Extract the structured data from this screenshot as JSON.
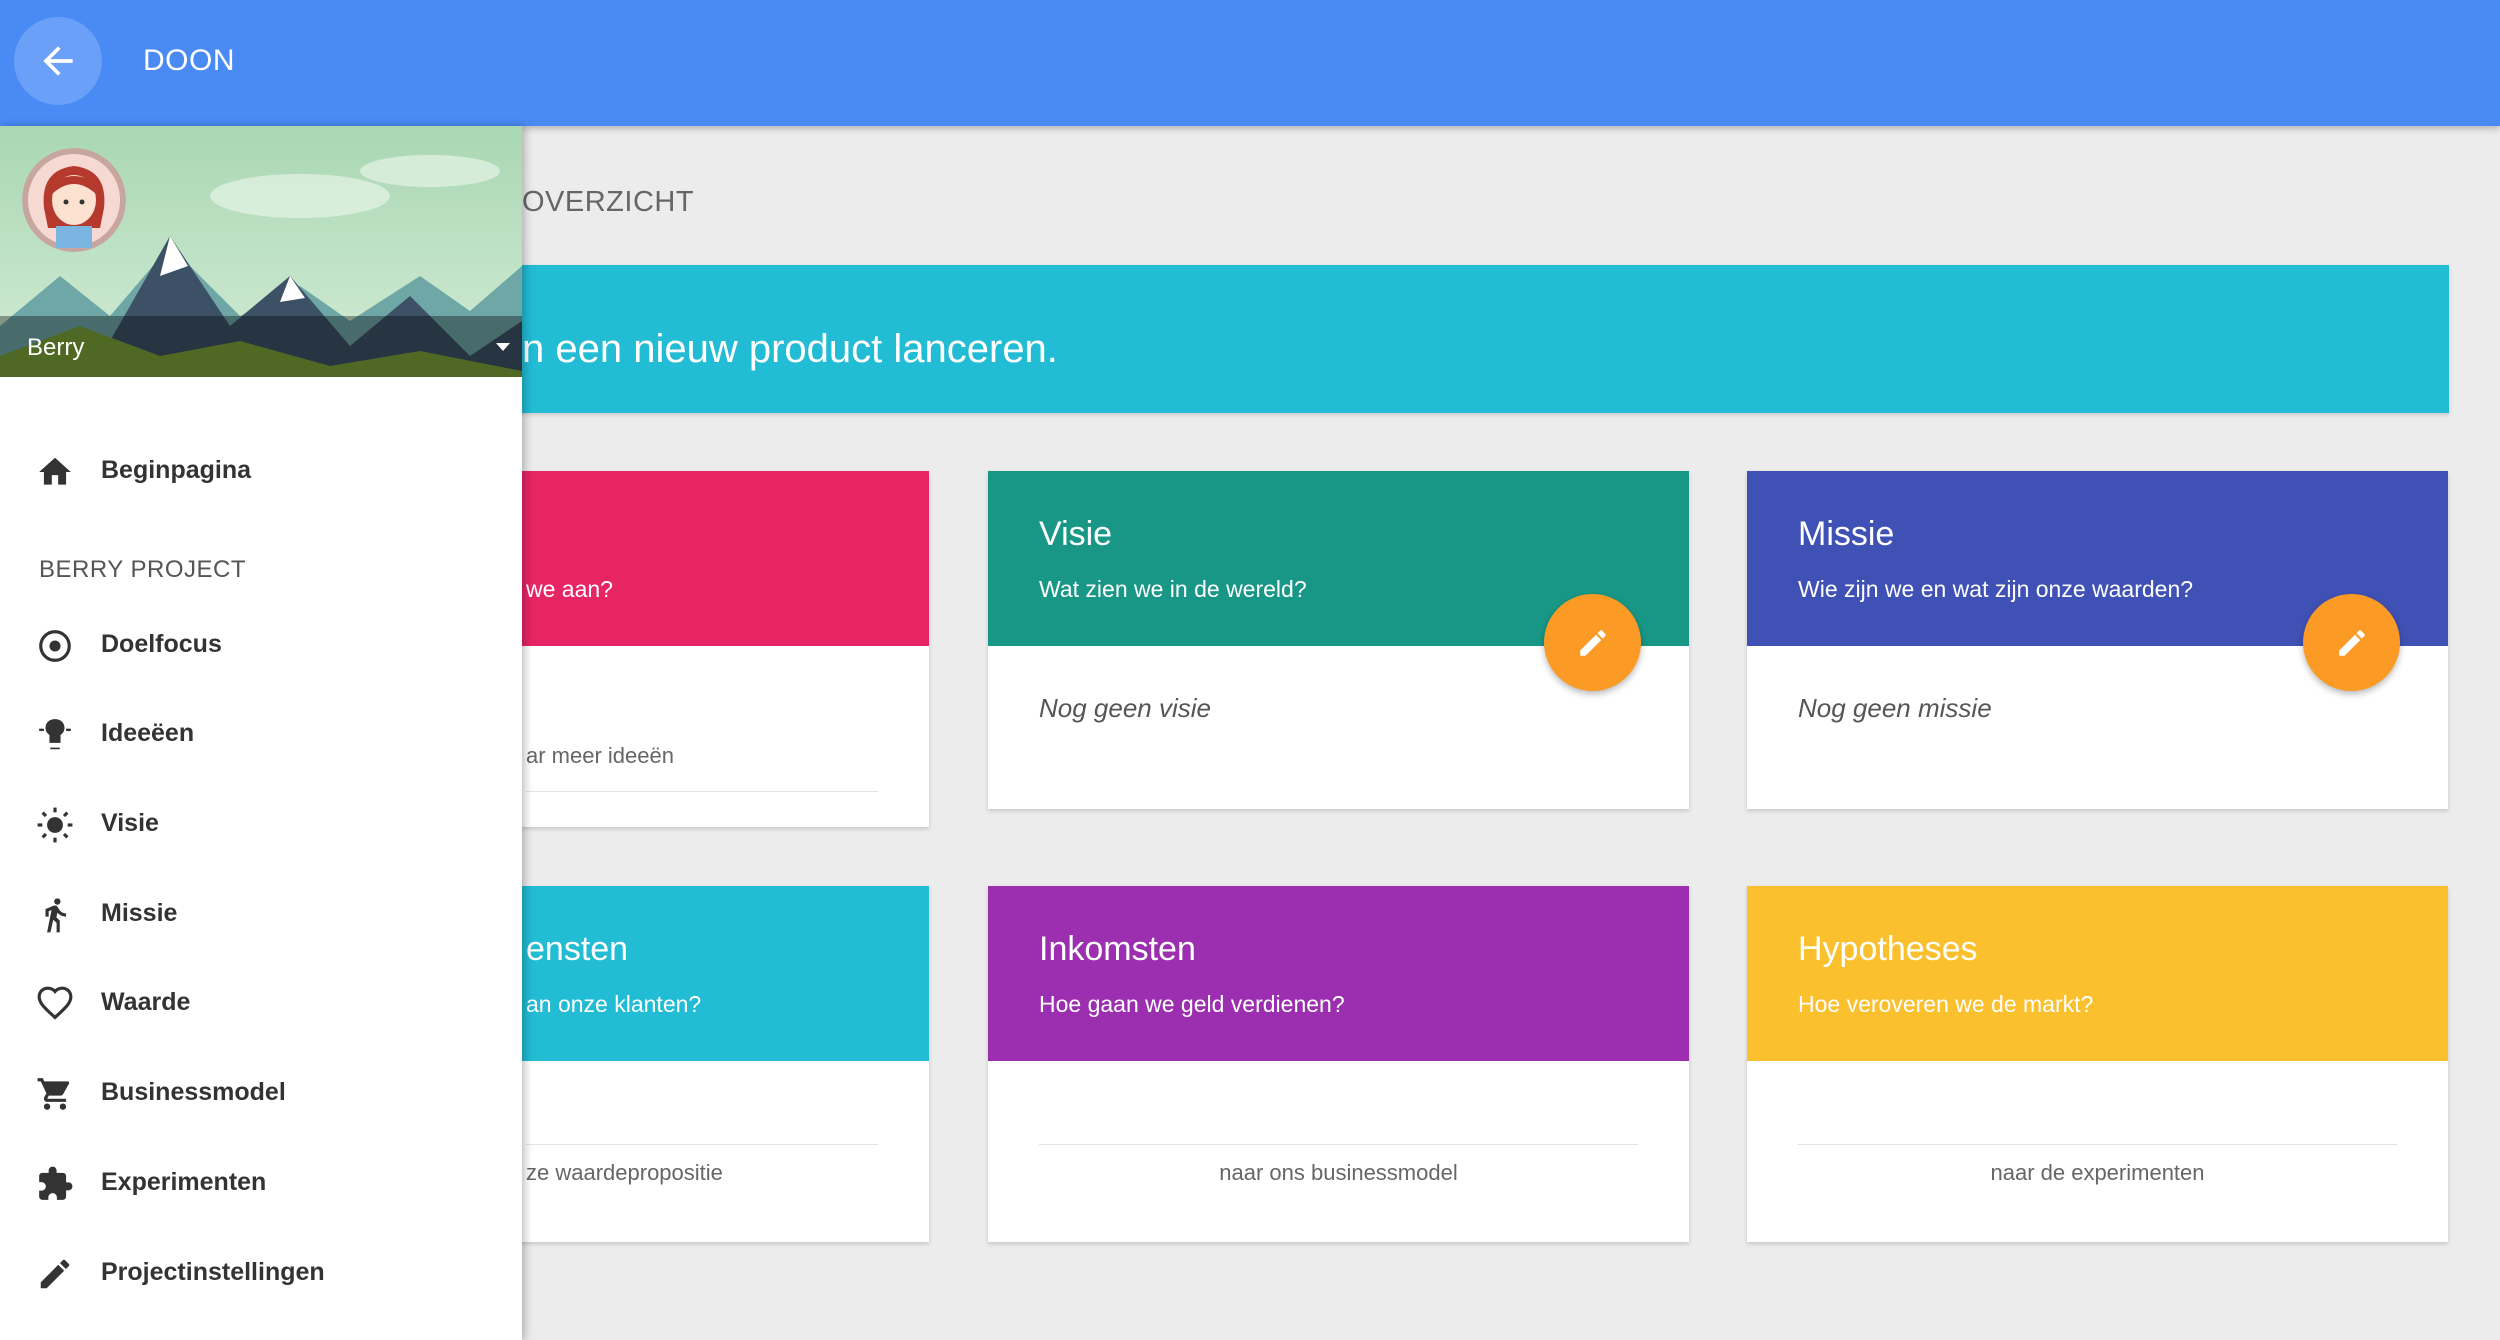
{
  "appbar": {
    "title": "DOON",
    "back_icon": "arrow-left-icon",
    "color": "#4a8af4"
  },
  "drawer": {
    "user_name": "Berry",
    "section_label": "BERRY PROJECT",
    "items": [
      {
        "label": "Beginpagina",
        "icon": "home-icon"
      },
      {
        "label": "Doelfocus",
        "icon": "target-icon"
      },
      {
        "label": "Ideeëen",
        "icon": "lightbulb-icon"
      },
      {
        "label": "Visie",
        "icon": "sun-icon"
      },
      {
        "label": "Missie",
        "icon": "walking-person-icon"
      },
      {
        "label": "Waarde",
        "icon": "heart-icon"
      },
      {
        "label": "Businessmodel",
        "icon": "cart-icon"
      },
      {
        "label": "Experimenten",
        "icon": "puzzle-icon"
      },
      {
        "label": "Projectinstellingen",
        "icon": "pencil-icon"
      }
    ]
  },
  "main": {
    "section_title": "OVERZICHT",
    "banner_text": "n een nieuw product lanceren.",
    "cards": [
      {
        "title": "",
        "subtitle": "we aan?",
        "body": "",
        "link": "ar meer ideeën",
        "color": "#e72564",
        "fab": false
      },
      {
        "title": "Visie",
        "subtitle": "Wat zien we in de wereld?",
        "body": "Nog geen visie",
        "link": "",
        "color": "#189787",
        "fab": true
      },
      {
        "title": "Missie",
        "subtitle": "Wie zijn we en wat zijn onze waarden?",
        "body": "Nog geen missie",
        "link": "",
        "color": "#3f51b5",
        "fab": true
      },
      {
        "title": "ensten",
        "subtitle": "an onze klanten?",
        "body": "",
        "link": "ze waardepropositie",
        "color": "#22bcd4",
        "fab": false
      },
      {
        "title": "Inkomsten",
        "subtitle": "Hoe gaan we geld verdienen?",
        "body": "",
        "link": "naar ons businessmodel",
        "color": "#9c2fb0",
        "fab": false
      },
      {
        "title": "Hypotheses",
        "subtitle": "Hoe veroveren we de markt?",
        "body": "",
        "link": "naar de experimenten",
        "color": "#fbc02d",
        "fab": false
      }
    ],
    "fab_icon": "pencil-icon",
    "fab_color": "#fb9b25"
  }
}
